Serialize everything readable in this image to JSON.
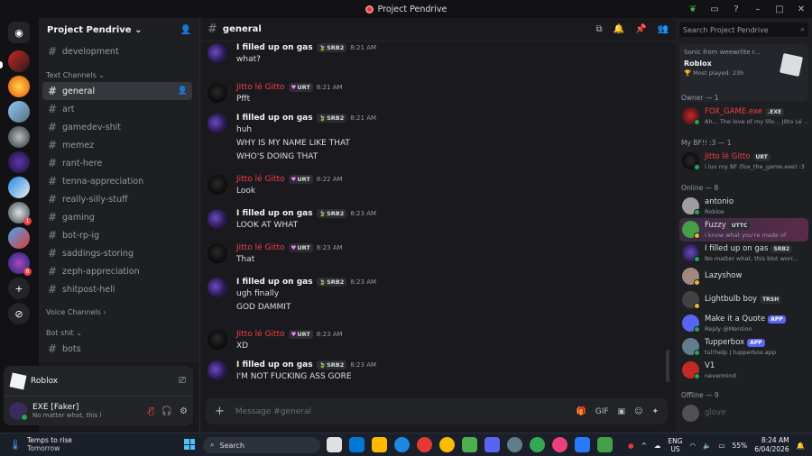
{
  "window": {
    "title": "Project Pendrive"
  },
  "guild": {
    "name": "Project Pendrive"
  },
  "channels": {
    "top": "development",
    "category_text": "Text Channels",
    "items": [
      "general",
      "art",
      "gamedev-shit",
      "memez",
      "rant-here",
      "tenna-appreciation",
      "really-silly-stuff",
      "gaming",
      "bot-rp-ig",
      "saddings-storing",
      "zeph-appreciation",
      "shitpost-hell"
    ],
    "active": "general",
    "category_voice": "Voice Channels",
    "category_bot": "Bot shit",
    "bot_items": [
      "bots"
    ]
  },
  "activity_panel": {
    "game": "Roblox"
  },
  "user_panel": {
    "name": "EXE [Faker]",
    "status": "No matter what, this l"
  },
  "chat": {
    "channel": "general",
    "placeholder": "Message #general",
    "messages": [
      {
        "author": "I filled up on gas",
        "tag": "SRB2",
        "time": "8:21 AM",
        "lines": [
          "what?"
        ]
      },
      {
        "author": "Jitto lé Gitto",
        "tag": "URT",
        "time": "8:21 AM",
        "lines": [
          "Pfft"
        ]
      },
      {
        "author": "I filled up on gas",
        "tag": "SRB2",
        "time": "8:21 AM",
        "lines": [
          "huh",
          "WHY IS MY NAME LIKE THAT",
          "WHO'S DOING THAT"
        ]
      },
      {
        "author": "Jitto lé Gitto",
        "tag": "URT",
        "time": "8:22 AM",
        "lines": [
          "Look"
        ]
      },
      {
        "author": "I filled up on gas",
        "tag": "SRB2",
        "time": "8:23 AM",
        "lines": [
          "LOOK AT WHAT"
        ]
      },
      {
        "author": "Jitto lé Gitto",
        "tag": "URT",
        "time": "8:23 AM",
        "lines": [
          "That"
        ]
      },
      {
        "author": "I filled up on gas",
        "tag": "SRB2",
        "time": "8:23 AM",
        "lines": [
          "ugh finally",
          "GOD DAMMIT"
        ]
      },
      {
        "author": "Jitto lé Gitto",
        "tag": "URT",
        "time": "8:23 AM",
        "lines": [
          "XD"
        ]
      },
      {
        "author": "I filled up on gas",
        "tag": "SRB2",
        "time": "8:23 AM",
        "lines": [
          "I'M NOT FUCKING ASS GORE"
        ]
      }
    ]
  },
  "members": {
    "search_placeholder": "Search Project Pendrive",
    "activity": {
      "line1": "Sonic from weewrlite r...",
      "game": "Roblox",
      "played": "Most played: 23h"
    },
    "owner_header": "Owner — 1",
    "owner": {
      "name": "FOX_GAME.exe",
      "tag": ".EXE",
      "status": "Ah... The love of my life... Jitto Lé ..."
    },
    "bf_header": "My BF!! :3 — 1",
    "bf": {
      "name": "Jitto lé Gitto",
      "tag": "URT",
      "status": "i luv my BF (fox_the_game.exe) :3"
    },
    "online_header": "Online — 8",
    "online": [
      {
        "name": "antonio",
        "tag": "",
        "status": "Roblox"
      },
      {
        "name": "Fuzzy",
        "tag": "UTTC",
        "status": "i know what you're made of"
      },
      {
        "name": "I filled up on gas",
        "tag": "SRB2",
        "status": "No matter what, this blot worr..."
      },
      {
        "name": "Lazyshow",
        "tag": "",
        "status": ""
      },
      {
        "name": "Lightbulb boy",
        "tag": "TRSH",
        "status": ""
      },
      {
        "name": "Make it a Quote",
        "tag": "APP",
        "status": "Reply @Mention"
      },
      {
        "name": "Tupperbox",
        "tag": "APP",
        "status": "tul!help | tupperbox.app"
      },
      {
        "name": "V1",
        "tag": "",
        "status": "nevermind"
      }
    ],
    "offline_header": "Offline — 9",
    "offline": [
      {
        "name": "glove"
      }
    ]
  },
  "taskbar": {
    "weather_line1": "Temps to rise",
    "weather_line2": "Tomorrow",
    "search": "Search",
    "lang1": "ENG",
    "lang2": "US",
    "battery": "55%",
    "time": "8:24 AM",
    "date": "6/04/2026"
  },
  "colors": {
    "accent": "#5865f2",
    "online": "#23a55a",
    "danger": "#f23f43"
  }
}
